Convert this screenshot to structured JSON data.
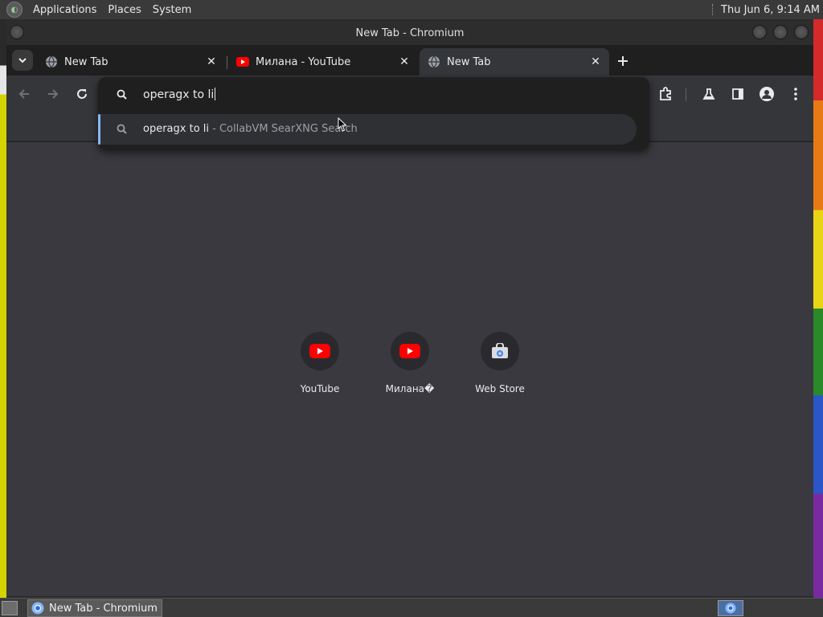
{
  "top_panel": {
    "menus": [
      "Applications",
      "Places",
      "System"
    ],
    "clock": "Thu Jun  6, 9:14 AM"
  },
  "window": {
    "title": "New Tab - Chromium"
  },
  "tabs": [
    {
      "label": "New Tab",
      "favicon": "globe-icon",
      "active": false
    },
    {
      "label": "Милана   - YouTube",
      "favicon": "youtube-icon",
      "active": false
    },
    {
      "label": "New Tab",
      "favicon": "globe-icon",
      "active": true
    }
  ],
  "omnibox": {
    "value": "operagx to li",
    "suggestion": {
      "query": "operagx to li",
      "description": " - CollabVM SearXNG Search"
    }
  },
  "shortcuts": [
    {
      "label": "YouTube",
      "icon": "youtube-icon"
    },
    {
      "label": "Милана�",
      "icon": "youtube-icon"
    },
    {
      "label": "Web Store",
      "icon": "web-store-icon"
    }
  ],
  "taskbar": {
    "task_label": "New Tab - Chromium"
  },
  "colors": {
    "accent": "#8ab4f8",
    "youtube_red": "#ff0000"
  }
}
